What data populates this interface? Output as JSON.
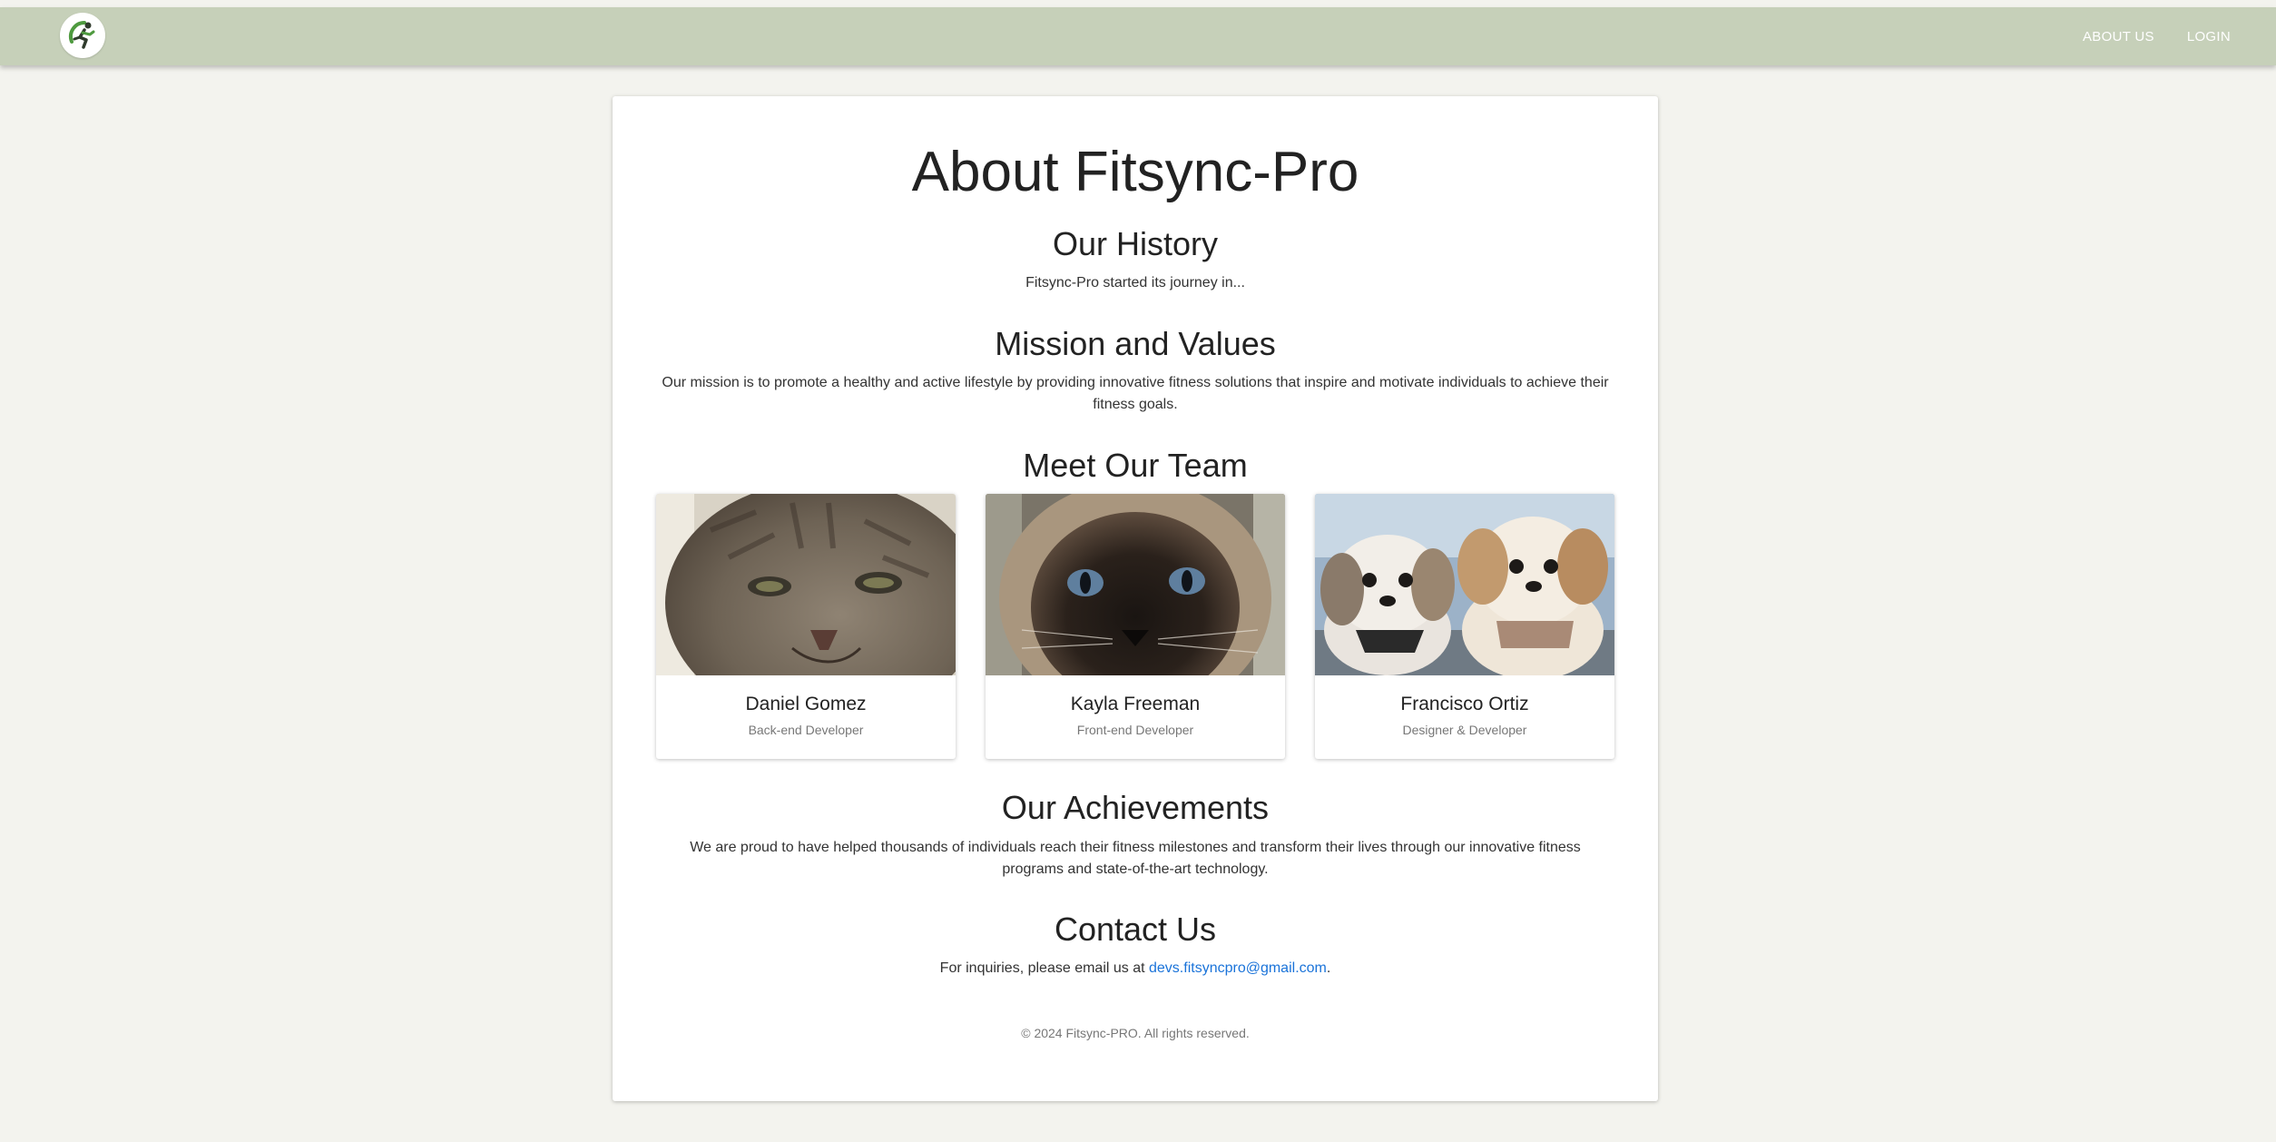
{
  "nav": {
    "logo_icon": "runner-logo-icon",
    "links": [
      {
        "label": "ABOUT US"
      },
      {
        "label": "LOGIN"
      }
    ]
  },
  "page": {
    "title": "About Fitsync-Pro"
  },
  "history": {
    "title": "Our History",
    "text": "Fitsync-Pro started its journey in..."
  },
  "mission": {
    "title": "Mission and Values",
    "text": "Our mission is to promote a healthy and active lifestyle by providing innovative fitness solutions that inspire and motivate individuals to achieve their fitness goals."
  },
  "team": {
    "title": "Meet Our Team",
    "members": [
      {
        "name": "Daniel Gomez",
        "role": "Back-end Developer"
      },
      {
        "name": "Kayla Freeman",
        "role": "Front-end Developer"
      },
      {
        "name": "Francisco Ortiz",
        "role": "Designer & Developer"
      }
    ]
  },
  "achievements": {
    "title": "Our Achievements",
    "text": "We are proud to have helped thousands of individuals reach their fitness milestones and transform their lives through our innovative fitness programs and state-of-the-art technology."
  },
  "contact": {
    "title": "Contact Us",
    "prefix": "For inquiries, please email us at ",
    "email": "devs.fitsyncpro@gmail.com",
    "suffix": "."
  },
  "footer": {
    "text": "© 2024 Fitsync-PRO. All rights reserved."
  },
  "colors": {
    "navbar": "#c6d0b9",
    "background": "#f3f3ee",
    "link": "#1a73d9",
    "logo_green": "#4e9a3f",
    "logo_dark": "#2f3b2c"
  }
}
